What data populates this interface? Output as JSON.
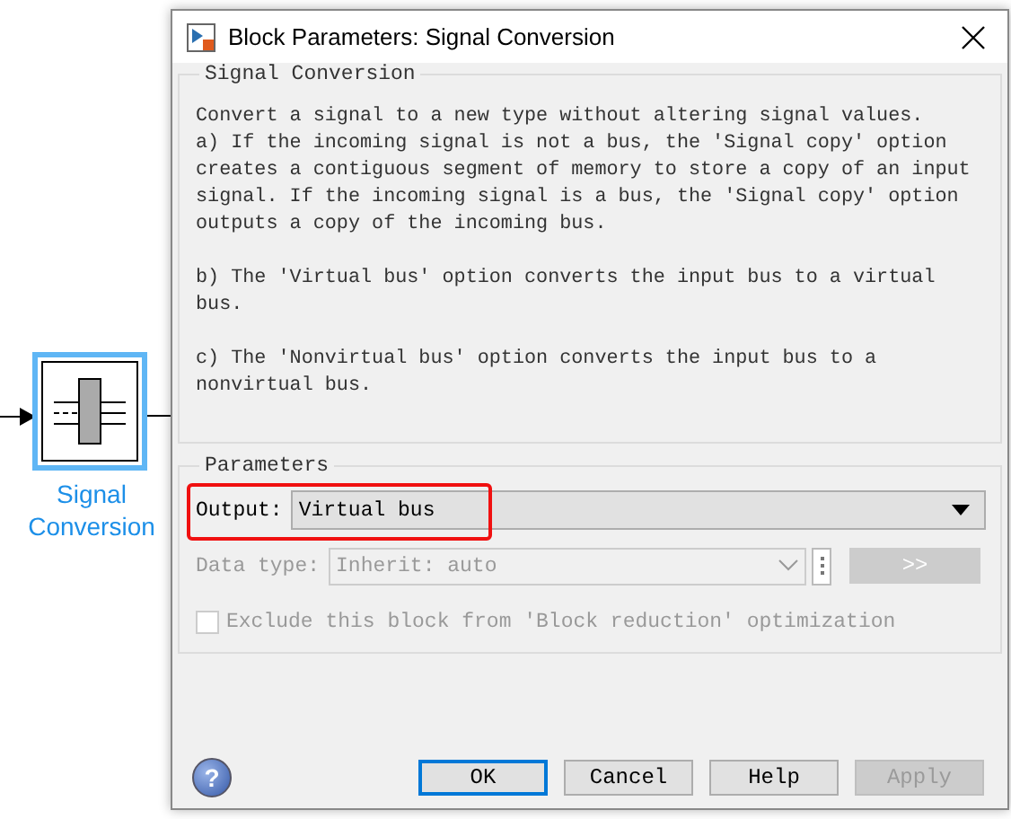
{
  "canvas": {
    "block": {
      "label": "Signal\nConversion",
      "selected": true
    }
  },
  "dialog": {
    "title": "Block Parameters: Signal Conversion",
    "description": {
      "heading": "Signal Conversion",
      "paragraphs": [
        "Convert a signal to a new type without altering signal values.",
        "a) If the incoming signal is not a bus, the 'Signal copy' option creates a contiguous segment of memory to store a copy of an input signal. If the incoming signal is a bus, the 'Signal copy' option outputs a copy of the incoming bus.",
        "b) The 'Virtual bus' option converts the input bus to a virtual bus.",
        "c) The 'Nonvirtual bus' option converts the input bus to a nonvirtual bus."
      ]
    },
    "parameters": {
      "heading": "Parameters",
      "output": {
        "label": "Output:",
        "value": "Virtual bus",
        "highlighted": true
      },
      "data_type": {
        "label": "Data type:",
        "value": "Inherit: auto",
        "disabled": true,
        "assistant_button": ">>"
      },
      "checkbox": {
        "label": "Exclude this block from 'Block reduction' optimization",
        "checked": false,
        "disabled": true
      }
    },
    "help": "?",
    "buttons": [
      {
        "label": "OK",
        "disabled": false,
        "default": true
      },
      {
        "label": "Cancel",
        "disabled": false,
        "default": false
      },
      {
        "label": "Help",
        "disabled": false,
        "default": false
      },
      {
        "label": "Apply",
        "disabled": true,
        "default": false
      }
    ]
  }
}
